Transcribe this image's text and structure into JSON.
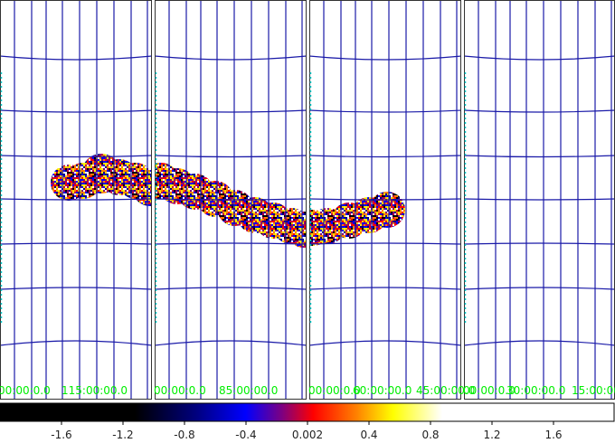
{
  "panels": [
    {
      "name": "panel-1",
      "coord_labels": [
        "00:00:0.0",
        "115:00:00.0"
      ]
    },
    {
      "name": "panel-2",
      "coord_labels": [
        "00:00:0.0",
        "85:00:00.0"
      ]
    },
    {
      "name": "panel-3",
      "coord_labels": [
        "00:00:0.0",
        "60:00:00.0",
        "45:00:00.0"
      ]
    },
    {
      "name": "panel-4",
      "coord_labels": [
        "00:00:0.0",
        "30:00:00.0",
        "15:00:00.0"
      ]
    }
  ],
  "colorbar": {
    "tick_labels": [
      "-1.6",
      "-1.2",
      "-0.8",
      "-0.4",
      "0.002",
      "0.4",
      "0.8",
      "1.2",
      "1.6"
    ],
    "colors": [
      "#000000",
      "#00007f",
      "#0000ff",
      "#7f007f",
      "#ff0000",
      "#ff8000",
      "#ffff00",
      "#ffffff"
    ]
  },
  "colors": {
    "grid": "#1a1aa8",
    "coord_label": "#00ee00",
    "panel_border": "#333333"
  }
}
